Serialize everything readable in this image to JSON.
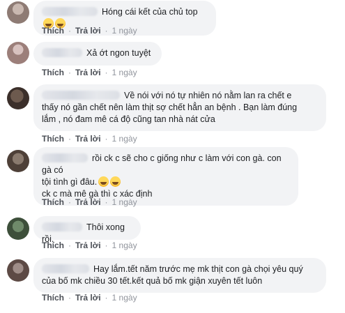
{
  "actions": {
    "like": "Thích",
    "reply": "Trả lời",
    "time": "1 ngày",
    "sep": "·"
  },
  "comments": [
    {
      "text": "Hóng cái kết của chủ top",
      "emoji": [
        "grinning-sweat-emoji",
        "grinning-sweat-emoji"
      ]
    },
    {
      "text": "Xả ớt ngon tuyệt"
    },
    {
      "text": "Về nói với nó tự nhiên nó nằm lan ra chết e\nthấy nó gần chết nên làm thịt sợ chết hẳn an bệnh . Bạn làm đúng\nlắm , nó đam mê cá độ cũng tan nhà nát cửa"
    },
    {
      "text_a": "rồi ck c sẽ cho c giống như c làm với con gà. con gà có\ntội tình gì đâu.",
      "text_b": "\nck c mà mê gà thì c xác định",
      "emoji": [
        "grinning-sweat-emoji",
        "grinning-sweat-emoji"
      ]
    },
    {
      "text": "Thôi xong rồi."
    },
    {
      "text": "Hay lắm.tết năm trước mẹ mk thịt con gà chọi yêu quý\ncủa bố mk chiều 30 tết.kết quả bố mk giận xuyên tết luôn"
    }
  ],
  "colors": {
    "bubble": "#f2f3f5",
    "link": "#4b4f56",
    "meta": "#90949c"
  }
}
